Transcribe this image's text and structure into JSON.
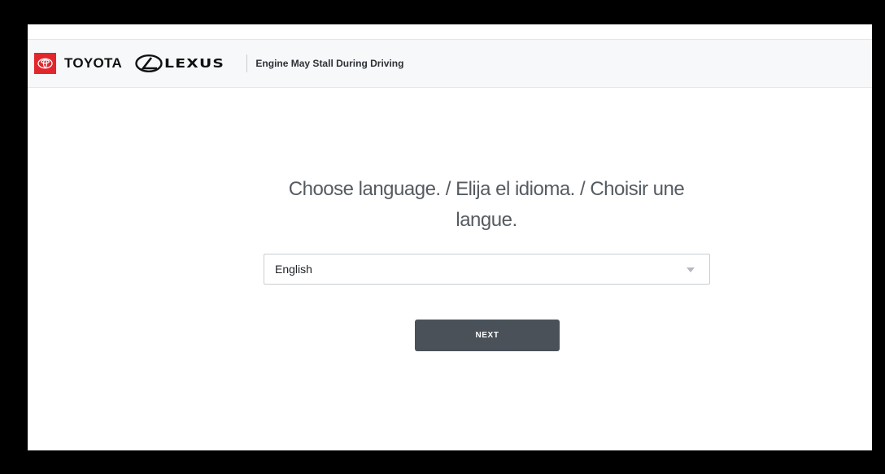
{
  "header": {
    "brand_toyota": "TOYOTA",
    "brand_lexus": "LEXUS",
    "title": "Engine May Stall During Driving"
  },
  "main": {
    "prompt": "Choose language. / Elija el idioma. / Choisir une langue.",
    "language_select": {
      "selected": "English"
    },
    "next_label": "NEXT"
  },
  "colors": {
    "toyota_red": "#e1262d",
    "button": "#4a5159",
    "prompt_text": "#555b61"
  }
}
